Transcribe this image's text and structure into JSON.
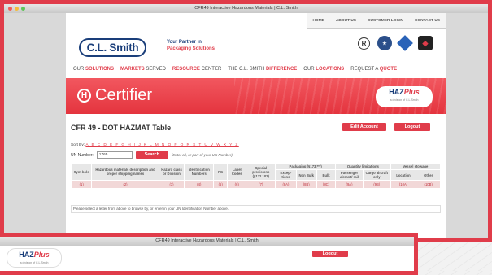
{
  "window": {
    "title": "CFR49 Interactive Hazardous Materials | C.L. Smith"
  },
  "topnav": [
    "HOME",
    "ABOUT US",
    "CUSTOMER LOGIN",
    "CONTACT US"
  ],
  "brand": {
    "logo": "C.L. Smith",
    "tagline_1": "Your Partner in",
    "tagline_2": "Packaging Solutions"
  },
  "mainnav": [
    {
      "pre": "OUR ",
      "bold": "SOLUTIONS",
      "post": ""
    },
    {
      "pre": "",
      "bold": "MARKETS",
      "post": " SERVED"
    },
    {
      "pre": "",
      "bold": "RESOURCE",
      "post": " CENTER"
    },
    {
      "pre": "THE C.L. SMITH ",
      "bold": "DIFFERENCE",
      "post": ""
    },
    {
      "pre": "OUR ",
      "bold": "LOCATIONS",
      "post": ""
    },
    {
      "pre": "REQUEST A ",
      "bold": "QUOTE",
      "post": ""
    }
  ],
  "banner": {
    "title": "Certifier",
    "hazplus": "HAZ",
    "hazplus_italic": "Plus",
    "hazplus_sub": "a division of C.L.Smith"
  },
  "page": {
    "title": "CFR 49 - DOT HAZMAT Table",
    "edit_account": "Edit Account",
    "logout": "Logout",
    "sort_label": "Sort By:",
    "letters": "A B C D E F G H I J K L M N O P Q R S T U V W X Y Z",
    "un_label": "UN Number:",
    "un_value": "1765",
    "search": "Search",
    "hint": "(Enter all, or part of your UN Number)",
    "note": "Please select a letter from above to browse by, or enter in your UN Identification Number above."
  },
  "table": {
    "group_packaging": "Packaging (§173.***)",
    "group_qty": "Quantity limitations",
    "group_vessel": "Vessel stowage",
    "headers": {
      "sym": "Sym-bols",
      "desc": "Hazardous materials description and proper shipping names",
      "class": "Hazard class or Division",
      "id": "Identification Numbers",
      "pg": "PG",
      "label": "Label Codes",
      "special": "Special provisions (§172.102)",
      "excep": "Excep-tions",
      "nonbulk": "Non Bulk",
      "bulk": "Bulk",
      "pass": "Passenger aircraft/ rail",
      "cargo": "Cargo aircraft only",
      "loc": "Location",
      "other": "Other"
    },
    "numbers": [
      "(1)",
      "(2)",
      "(3)",
      "(4)",
      "(5)",
      "(6)",
      "(7)",
      "(8A)",
      "(8B)",
      "(8C)",
      "(9A)",
      "(9B)",
      "(10A)",
      "(10B)"
    ]
  },
  "window2": {
    "title": "CFR49 Interactive Hazardous Materials | C.L. Smith",
    "logout": "Logout"
  }
}
